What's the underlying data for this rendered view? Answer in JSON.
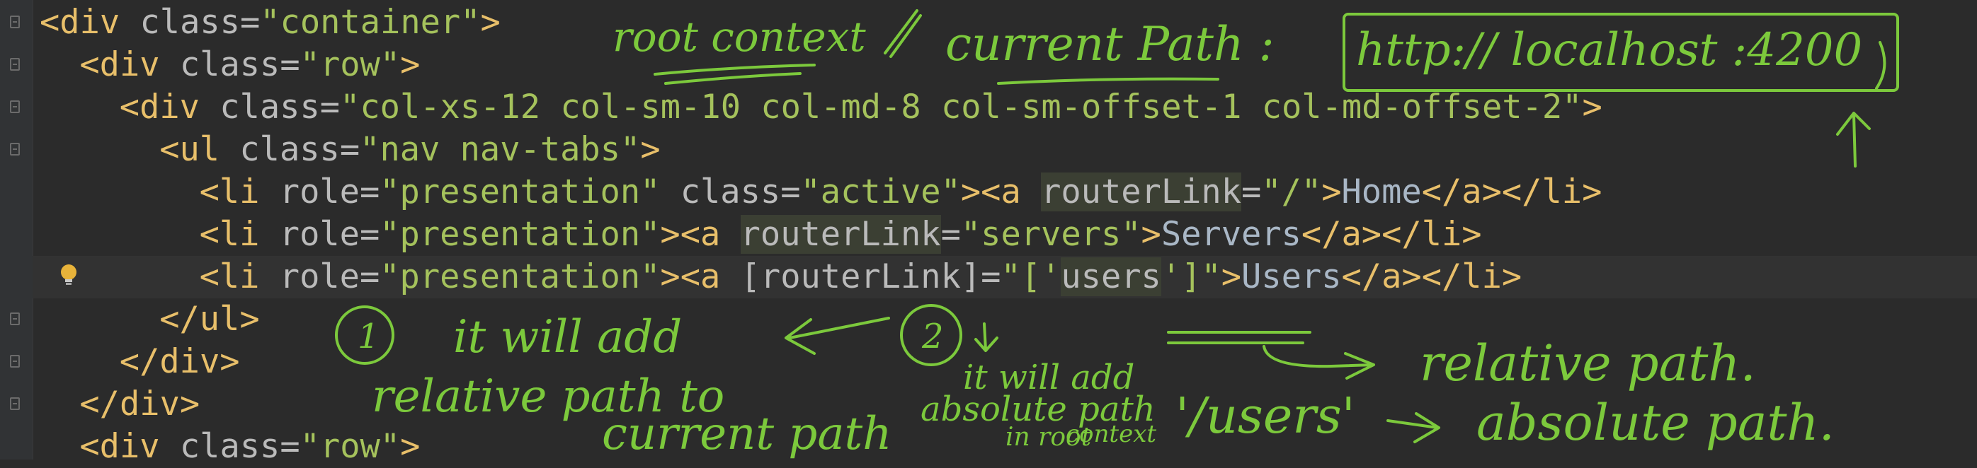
{
  "editor": {
    "lines": [
      {
        "indent": "",
        "parts": [
          [
            "tag",
            "<div"
          ],
          [
            "attr",
            " class="
          ],
          [
            "val",
            "\"container\""
          ],
          [
            "tag",
            ">"
          ]
        ]
      },
      {
        "indent": "  ",
        "parts": [
          [
            "tag",
            "<div"
          ],
          [
            "attr",
            " class="
          ],
          [
            "val",
            "\"row\""
          ],
          [
            "tag",
            ">"
          ]
        ]
      },
      {
        "indent": "    ",
        "parts": [
          [
            "tag",
            "<div"
          ],
          [
            "attr",
            " class="
          ],
          [
            "val",
            "\"col-xs-12 col-sm-10 col-md-8 col-sm-offset-1 col-md-offset-2\""
          ],
          [
            "tag",
            ">"
          ]
        ]
      },
      {
        "indent": "      ",
        "parts": [
          [
            "tag",
            "<ul"
          ],
          [
            "attr",
            " class="
          ],
          [
            "val",
            "\"nav nav-tabs\""
          ],
          [
            "tag",
            ">"
          ]
        ]
      },
      {
        "indent": "        ",
        "parts": [
          [
            "tag",
            "<li"
          ],
          [
            "attr",
            " role="
          ],
          [
            "val",
            "\"presentation\""
          ],
          [
            "attr",
            " class="
          ],
          [
            "val",
            "\"active\""
          ],
          [
            "tag",
            "><a"
          ],
          [
            "attr",
            " "
          ],
          [
            "hl",
            "routerLink"
          ],
          [
            "attr",
            "="
          ],
          [
            "val",
            "\"/\""
          ],
          [
            "tag",
            ">"
          ],
          [
            "text",
            "Home"
          ],
          [
            "tag",
            "</a></li>"
          ]
        ]
      },
      {
        "indent": "        ",
        "parts": [
          [
            "tag",
            "<li"
          ],
          [
            "attr",
            " role="
          ],
          [
            "val",
            "\"presentation\""
          ],
          [
            "tag",
            "><a"
          ],
          [
            "attr",
            " "
          ],
          [
            "hl",
            "routerLink"
          ],
          [
            "attr",
            "="
          ],
          [
            "val",
            "\"servers\""
          ],
          [
            "tag",
            ">"
          ],
          [
            "text",
            "Servers"
          ],
          [
            "tag",
            "</a></li>"
          ]
        ]
      },
      {
        "indent": "        ",
        "parts": [
          [
            "tag",
            "<li"
          ],
          [
            "attr",
            " role="
          ],
          [
            "val",
            "\"presentation\""
          ],
          [
            "tag",
            "><a"
          ],
          [
            "attr",
            " [routerLink]="
          ],
          [
            "val",
            "\"['"
          ],
          [
            "hl",
            "users"
          ],
          [
            "val",
            "']\""
          ],
          [
            "tag",
            ">"
          ],
          [
            "text",
            "Users"
          ],
          [
            "tag",
            "</a></li>"
          ]
        ]
      },
      {
        "indent": "      ",
        "parts": [
          [
            "tag",
            "</ul>"
          ]
        ]
      },
      {
        "indent": "    ",
        "parts": [
          [
            "tag",
            "</div>"
          ]
        ]
      },
      {
        "indent": "  ",
        "parts": [
          [
            "tag",
            "</div>"
          ]
        ]
      },
      {
        "indent": "  ",
        "parts": [
          [
            "tag",
            "<div"
          ],
          [
            "attr",
            " class="
          ],
          [
            "val",
            "\"row\""
          ],
          [
            "tag",
            ">"
          ]
        ]
      }
    ]
  },
  "annotations": {
    "root_context": "root context",
    "current_path_label": "current Path :",
    "current_path_value": "http:// localhost :4200",
    "marker_1": "1",
    "marker_2": "2",
    "note1_line1": "it will add",
    "note1_line2": "relative path to",
    "note1_line3": "current path",
    "note2_line1": "it will add",
    "note2_line2": "absolute path",
    "note2_line3": "in root",
    "note2_line4": "context",
    "users_quote": "'/users'",
    "relative_path": "relative path.",
    "absolute_path": "absolute path."
  },
  "colors": {
    "background": "#2b2b2b",
    "ink": "#7cc93c",
    "tag": "#e8bf6a",
    "attribute": "#bababa",
    "string": "#a5c25c",
    "text": "#a9b7c6"
  }
}
